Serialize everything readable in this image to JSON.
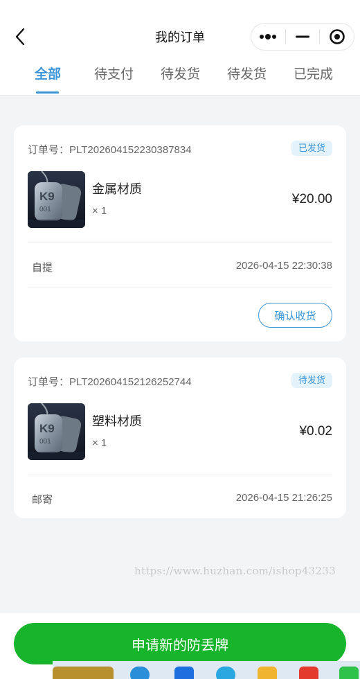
{
  "nav": {
    "title": "我的订单"
  },
  "tabs": [
    {
      "label": "全部",
      "active": true
    },
    {
      "label": "待支付",
      "active": false
    },
    {
      "label": "待发货",
      "active": false
    },
    {
      "label": "待发货",
      "active": false
    },
    {
      "label": "已完成",
      "active": false
    }
  ],
  "orders": [
    {
      "order_no": "订单号：PLT20260415223038783​4",
      "status": "已发货",
      "product": {
        "name": "金属材质",
        "qty": "× 1",
        "image": "dog-tag-k9-image"
      },
      "price": "¥20.00",
      "shipping": "自提",
      "time": "2026-04-15 22:30:38",
      "action": "确认收货"
    },
    {
      "order_no": "订单号：PLT20260415212625274​4",
      "status": "待发货",
      "product": {
        "name": "塑料材质",
        "qty": "× 1",
        "image": "dog-tag-k9-image"
      },
      "price": "¥0.02",
      "shipping": "邮寄",
      "time": "2026-04-15 21:26:25"
    }
  ],
  "watermark": "https://www.huzhan.com/ishop43233",
  "bottom": {
    "apply_label": "申请新的防丢牌"
  },
  "colors": {
    "accent": "#3b95d8",
    "primary_button": "#17b52b",
    "badge_bg": "#e4f3fb"
  }
}
